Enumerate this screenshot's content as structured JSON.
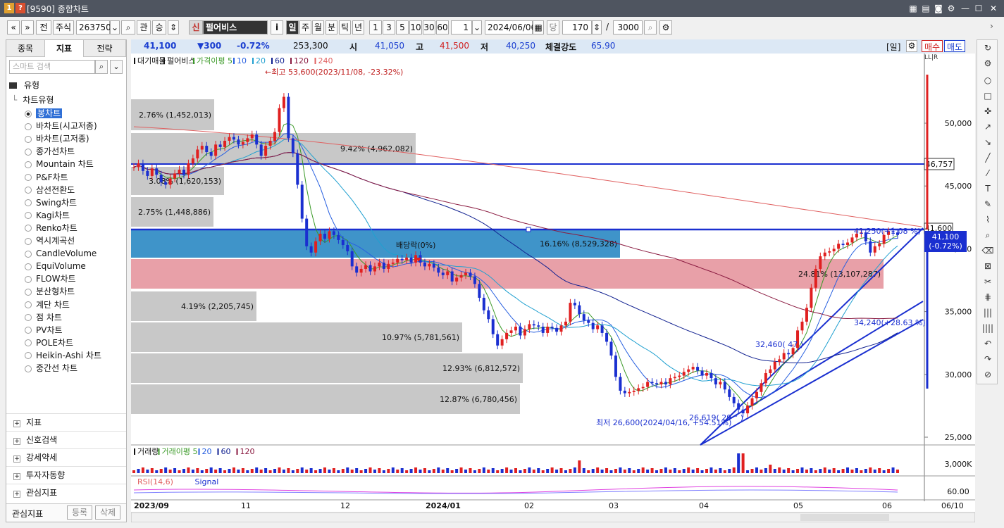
{
  "window": {
    "num1": "1",
    "num2": "?",
    "title": "[9590] 종합차트"
  },
  "toolbar": {
    "prev": "«",
    "next": "»",
    "jeon": "전",
    "type": "주식",
    "code": "263750",
    "gwan": "관",
    "rank": "승",
    "sin": "신",
    "stock_name": "펄어비스",
    "info": "i",
    "periods": [
      "일",
      "주",
      "월",
      "분",
      "틱",
      "년"
    ],
    "active_period": "일",
    "nums": [
      "1",
      "3",
      "5",
      "10",
      "30",
      "60"
    ],
    "unit": "1",
    "date": "2024/06/06",
    "dang": "당",
    "count": "170",
    "slash": "/",
    "total": "3000"
  },
  "left_panel": {
    "tabs": [
      "종목",
      "지표",
      "전략"
    ],
    "active_tab": "지표",
    "search_placeholder": "스마트 검색",
    "type_header": "유형",
    "chart_group": "차트유형",
    "chart_types": [
      "봉차트",
      "바차트(시고저종)",
      "바차트(고저종)",
      "종가선차트",
      "Mountain 차트",
      "P&F차트",
      "삼선전환도",
      "Swing차트",
      "Kagi차트",
      "Renko차트",
      "역시계곡선",
      "CandleVolume",
      "EquiVolume",
      "FLOW차트",
      "분산형차트",
      "계단 차트",
      "점 차트",
      "PV차트",
      "POLE차트",
      "Heikin-Ashi 차트",
      "중간선 차트"
    ],
    "selected_chart_type": "봉차트",
    "sections": [
      "지표",
      "신호검색",
      "강세약세",
      "투자자동향",
      "관심지표"
    ],
    "footer_label": "관심지표",
    "footer_add": "등록",
    "footer_delete": "삭제"
  },
  "infobar": {
    "price": "41,100",
    "change": "▼300",
    "change_pct": "-0.72%",
    "volume": "253,300",
    "open_label": "시",
    "open": "41,050",
    "high_label": "고",
    "high": "41,500",
    "low_label": "저",
    "low": "40,250",
    "strength_label": "체결강도",
    "strength": "65.90",
    "period_tag": "[일]",
    "buy": "매수",
    "sell": "매도"
  },
  "legend": {
    "main": [
      "대기매물",
      "펄어비스",
      "가격이평 5",
      "10",
      "20",
      "60",
      "120",
      "240"
    ],
    "volume": [
      "거래량",
      "거래이평 5",
      "20",
      "60",
      "120"
    ],
    "rsi": [
      "RSI(14,6)",
      "Signal"
    ]
  },
  "chart_data": {
    "type": "candlestick",
    "ylim": [
      25000,
      54000
    ],
    "price_ticks": [
      "50,000",
      "45,000",
      "40,000",
      "35,000",
      "30,000",
      "25,000"
    ],
    "x_ticks": [
      "2023/09",
      "11",
      "12",
      "2024/01",
      "02",
      "03",
      "04",
      "05",
      "06",
      "06/10"
    ],
    "current_price_label": "41,600",
    "current_change_label": "41,100",
    "current_pct_label": "(-0.72%)",
    "hline_label": "46,757",
    "vol_tick": "3,000K",
    "rsi_tick": "60.00",
    "annotations": {
      "high": "←최고 53,600(2023/11/08, -23.32%)",
      "low": "최저 26,600(2024/04/16, +54.51%)",
      "dividend": "배당락(0%)",
      "p1": "41,250(+1.08 %)",
      "p2": "24.81% (13,107,287)",
      "p3": "34,240(+28.63 %)",
      "p4": "32,460( 47 )",
      "p5": "26,619( 29 ° )"
    },
    "volume_profile": [
      {
        "label": "2.76% (1,452,013)",
        "pct": 2.76
      },
      {
        "label": "9.42% (4,962,082)",
        "pct": 9.42
      },
      {
        "label": "3.08% (1,620,153)",
        "pct": 3.08
      },
      {
        "label": "2.75% (1,448,886)",
        "pct": 2.75
      },
      {
        "label": "16.16% (8,529,328)",
        "pct": 16.16
      },
      {
        "label": "24.81% (13,107,287)",
        "pct": 24.81
      },
      {
        "label": "4.19% (2,205,745)",
        "pct": 4.19
      },
      {
        "label": "10.97% (5,781,561)",
        "pct": 10.97
      },
      {
        "label": "12.93% (6,812,572)",
        "pct": 12.93
      },
      {
        "label": "12.87% (6,780,456)",
        "pct": 12.87
      }
    ],
    "closes": [
      46500,
      46800,
      46200,
      45800,
      46400,
      45900,
      45300,
      45100,
      45600,
      46000,
      46300,
      45900,
      46800,
      47200,
      47900,
      48200,
      47700,
      47400,
      48300,
      48100,
      48600,
      48900,
      48700,
      48300,
      48500,
      48800,
      49100,
      48300,
      47400,
      48200,
      48600,
      49300,
      51200,
      52100,
      48800,
      47600,
      45100,
      42400,
      40200,
      39700,
      40600,
      41200,
      40800,
      41400,
      41100,
      40700,
      40300,
      39800,
      38600,
      38100,
      38400,
      38700,
      38200,
      38600,
      38900,
      38400,
      38800,
      38900,
      39200,
      39100,
      39300,
      38900,
      39500,
      38900,
      38600,
      38800,
      38500,
      38100,
      37900,
      38200,
      37400,
      37700,
      37900,
      38100,
      37800,
      37200,
      36100,
      35100,
      34400,
      33200,
      32300,
      32800,
      33300,
      33500,
      33800,
      33100,
      33600,
      34000,
      33900,
      33800,
      33300,
      33800,
      33700,
      33400,
      33900,
      34200,
      35700,
      35500,
      34800,
      34300,
      34100,
      33600,
      33900,
      33300,
      32600,
      31500,
      29800,
      28700,
      28500,
      28600,
      28700,
      28900,
      29000,
      29400,
      29300,
      29200,
      29400,
      29200,
      29700,
      29800,
      29900,
      30200,
      30400,
      30600,
      30300,
      29900,
      30100,
      29700,
      29200,
      29400,
      28800,
      28200,
      27700,
      27200,
      26900,
      27500,
      28100,
      28600,
      29300,
      30100,
      30400,
      31000,
      31200,
      31700,
      31600,
      32100,
      33500,
      34200,
      35300,
      36900,
      38400,
      39400,
      39700,
      39800,
      40000,
      40400,
      40300,
      40500,
      40900,
      41200,
      41300,
      40600,
      39700,
      40200,
      40400,
      41100,
      41400,
      41300,
      41100
    ]
  }
}
